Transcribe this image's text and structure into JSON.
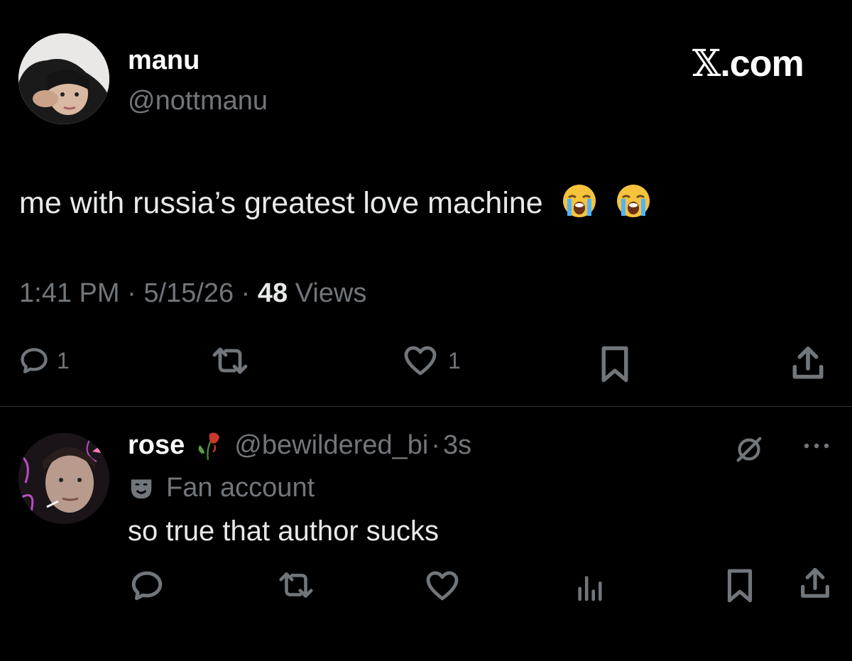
{
  "brand": {
    "text": ".com",
    "mark": "𝕏"
  },
  "tweet": {
    "author": {
      "name": "manu",
      "handle": "@nottmanu"
    },
    "text": "me with russia’s greatest love machine",
    "emojis": [
      "loudly-crying-face",
      "loudly-crying-face"
    ],
    "time": "1:41 PM",
    "sep1": "·",
    "date": "5/15/26",
    "sep2": "·",
    "views_count": "48",
    "views_label": "Views",
    "actions": {
      "replies": "1",
      "likes": "1"
    }
  },
  "reply": {
    "author": {
      "name": "rose",
      "handle": "@bewildered_bi",
      "sep": "·",
      "time": "3s"
    },
    "name_emoji": "wilted-flower",
    "label": "Fan account",
    "label_icon": "theater-mask-icon",
    "text": "so true that author sucks"
  },
  "colors": {
    "background": "#000000",
    "text": "#e7e9ea",
    "muted": "#71767b",
    "divider": "#2f3336"
  }
}
